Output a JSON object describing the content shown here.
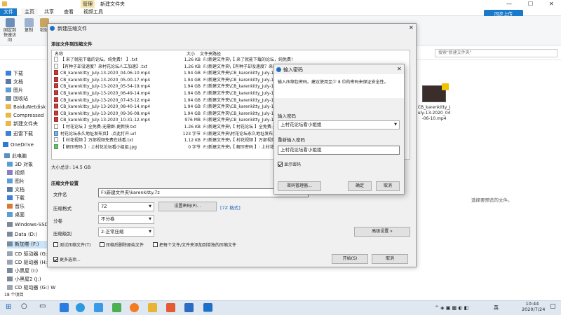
{
  "explorer": {
    "title_tabs": [
      "管理",
      "新建文件夹"
    ],
    "ribbon_tabs": [
      "文件",
      "主页",
      "共享",
      "查看",
      "视频工具"
    ],
    "ribbon_buttons": [
      "固定到快速访问",
      "复制",
      "粘贴"
    ],
    "search_placeholder": "搜索\"新建文件夹\"",
    "sync_label": "同步上传",
    "nav": [
      "下载",
      "文档",
      "图片",
      "回收站",
      "BaiduNetdisk",
      "Compressed",
      "新建文件夹",
      "迅雷下载",
      "OneDrive",
      "此电脑",
      "3D 对象",
      "视频",
      "图片",
      "文档",
      "下载",
      "音乐",
      "桌面",
      "Windows-SSD",
      "Data (D:)",
      "新加卷 (F:)",
      "CD 驱动器 (G:)",
      "CD 驱动器 (H:)",
      "小黑屋 (I:)",
      "小黑屋2 (J:)",
      "CD 驱动器 (G:) W"
    ],
    "file_thumb_label": "CB_karenkitty_July-13-2020_04-06-10.mp4",
    "preview_text": "选择要预览的文件。",
    "status": "18 个项目"
  },
  "dialog": {
    "title": "新建压缩文件",
    "section_add": "添加文件到压缩文件",
    "col_name": "名称",
    "col_size": "大小",
    "col_path": "文件夹路径",
    "files": [
      {
        "name": "【 来了就能下载的论坛，纯免费！ 】.txt",
        "size": "1.26 KB",
        "path": "F:\\新建文件夹\\【 来了就能下载的论坛，纯免费！",
        "icon": "txt"
      },
      {
        "name": "【有种子却没速度？来村花论坛人工加速】.txt",
        "size": "1.26 KB",
        "path": "F:\\新建文件夹\\【有种子却没速度？来村花",
        "icon": "txt"
      },
      {
        "name": "CB_karenkitty_July-13-2020_04-06-10.mp4",
        "size": "1.94 GB",
        "path": "F:\\新建文件夹\\CB_karenkitty_July-13-20",
        "icon": "mp4"
      },
      {
        "name": "CB_karenkitty_July-13-2020_05-00-17.mp4",
        "size": "1.94 GB",
        "path": "F:\\新建文件夹\\CB_karenkitty_July-13-20",
        "icon": "mp4"
      },
      {
        "name": "CB_karenkitty_July-13-2020_05-54-19.mp4",
        "size": "1.94 GB",
        "path": "F:\\新建文件夹\\CB_karenkitty_July-13-20",
        "icon": "mp4"
      },
      {
        "name": "CB_karenkitty_July-13-2020_06-49-14.mp4",
        "size": "1.94 GB",
        "path": "F:\\新建文件夹\\CB_karenkitty_July-13-20",
        "icon": "mp4"
      },
      {
        "name": "CB_karenkitty_July-13-2020_07-43-12.mp4",
        "size": "1.94 GB",
        "path": "F:\\新建文件夹\\CB_karenkitty_July-13-20",
        "icon": "mp4"
      },
      {
        "name": "CB_karenkitty_July-13-2020_08-40-14.mp4",
        "size": "1.94 GB",
        "path": "F:\\新建文件夹\\CB_karenkitty_July-13-20",
        "icon": "mp4"
      },
      {
        "name": "CB_karenkitty_July-13-2020_09-36-08.mp4",
        "size": "1.94 GB",
        "path": "F:\\新建文件夹\\CB_karenkitty_July-13-20",
        "icon": "mp4"
      },
      {
        "name": "CB_karenkitty_July-13-2020_10-31-12.mp4",
        "size": "976 MB",
        "path": "F:\\新建文件夹\\CB_karenkitty_July-13-20",
        "icon": "mp4"
      },
      {
        "name": "【 村花论坛 】全免费-无需群-更新快.txt",
        "size": "1.26 KB",
        "path": "F:\\新建文件夹\\【 村花论坛 】全免费-无",
        "icon": "txt"
      },
      {
        "name": "村花论坛永久地址发布页】-点此打开.url",
        "size": "123 字节",
        "path": "F:\\新建文件夹\\村花论坛永久地址发布页",
        "icon": "url"
      },
      {
        "name": "【 村花视频 】万部视频免费在线看.txt",
        "size": "1.12 KB",
        "path": "F:\\新建文件夹\\【 村花视频 】万部视频",
        "icon": "txt"
      },
      {
        "name": "【 解压密码 】: 上村花论坛看小姐姐.jpg",
        "size": "0 字节",
        "path": "F:\\新建文件夹\\【 解压密码 】: 上村花",
        "icon": "jpg"
      }
    ],
    "total_size": "大小总计: 14.5 GB",
    "section_settings": "压缩文件设置",
    "label_archive": "文件名",
    "archive_path": "F:\\新建文件夹\\karenkitty.7z",
    "label_format": "压缩格式",
    "format_value": "7Z",
    "set_password_btn": "设置密码(P)...",
    "format_link": "[7Z 格式]",
    "label_split": "分卷",
    "split_value": "不分卷",
    "label_level": "压缩级别",
    "level_value": "2-正常压缩",
    "advanced_btn": "高级设置 »",
    "opt_test": "测试压缩文件(T)",
    "opt_delete": "压缩后删除原始文件",
    "opt_separate": "把每个文件/文件夹添加到单独的压缩文件",
    "opt_more": "更多选项...",
    "start_btn": "开始(S)",
    "cancel_btn": "取消"
  },
  "pwd_dialog": {
    "title": "输入密码",
    "desc": "输入压缩包密码。建议使用至少 8 位的密码来保证安全性。",
    "label_pwd": "输入密码",
    "pwd_value": "上村花论坛看小姐姐",
    "label_repeat": "重新输入密码",
    "repeat_value": "上村花论坛看小姐姐",
    "show_pwd": "显示密码",
    "manage_btn": "密码管理器...",
    "ok_btn": "确定",
    "cancel_btn": "取消"
  },
  "taskbar": {
    "lang": "英",
    "time": "10:44",
    "date": "2020/7/24"
  }
}
